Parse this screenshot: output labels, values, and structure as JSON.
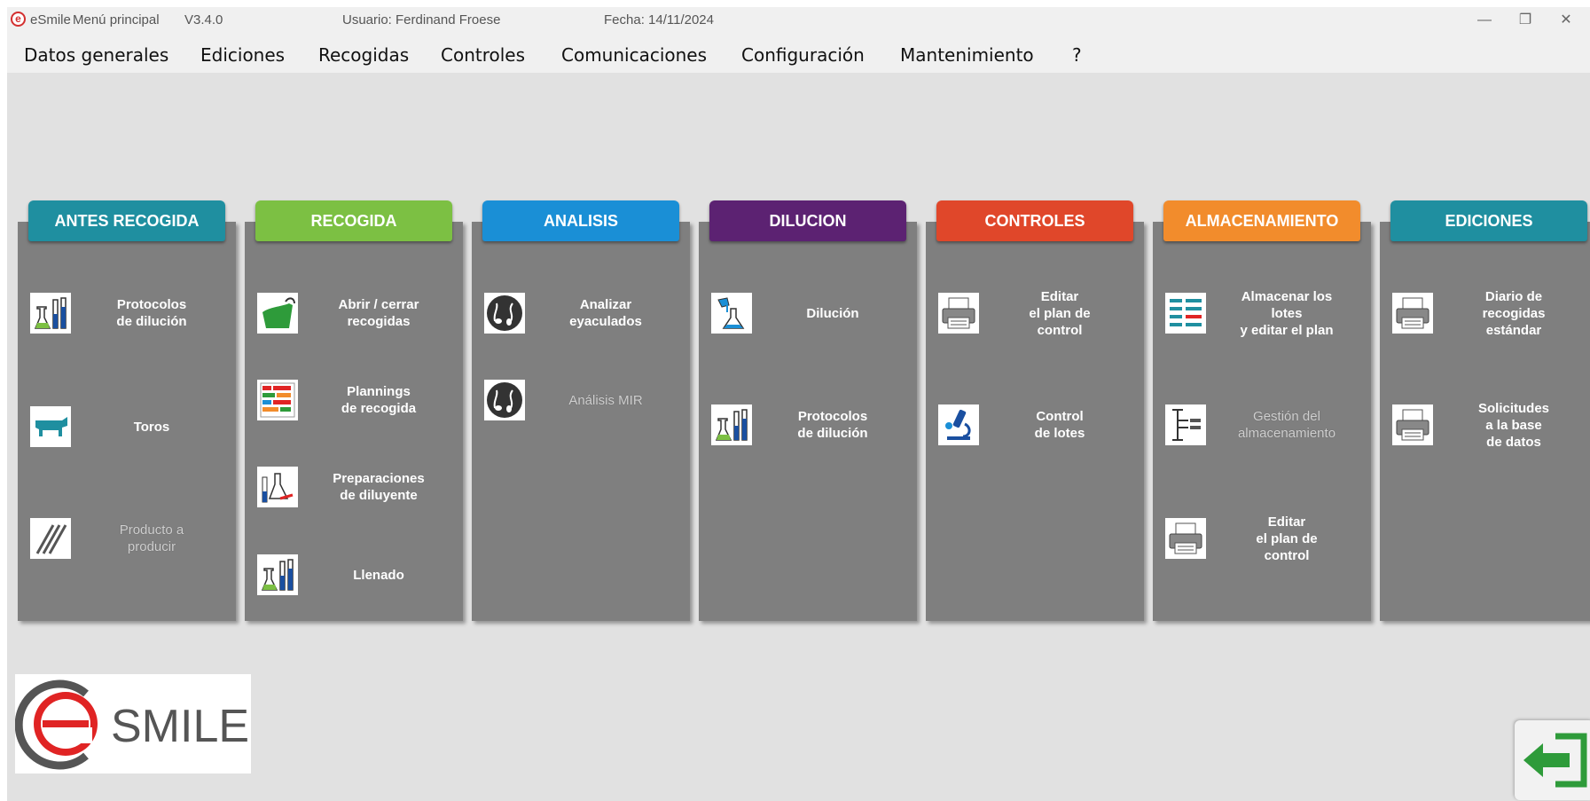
{
  "titlebar": {
    "app": "eSmile",
    "menu": "Menú principal",
    "version": "V3.4.0",
    "user": "Usuario: Ferdinand Froese",
    "date": "Fecha: 14/11/2024"
  },
  "menu": [
    "Datos generales",
    "Ediciones",
    "Recogidas",
    "Controles",
    "Comunicaciones",
    "Configuración",
    "Mantenimiento",
    "?"
  ],
  "panels": [
    {
      "title": "ANTES RECOGIDA",
      "color": "#1f8fa0",
      "items": [
        {
          "lines": [
            "Protocolos",
            "de dilución"
          ],
          "icon": "flask-tubes-icon",
          "enabled": true
        },
        {
          "lines": [
            "Toros"
          ],
          "icon": "bull-icon",
          "enabled": true
        },
        {
          "lines": [
            "Producto a",
            "producir"
          ],
          "icon": "straws-icon",
          "enabled": false
        }
      ]
    },
    {
      "title": "RECOGIDA",
      "color": "#7cc043",
      "items": [
        {
          "lines": [
            "Abrir / cerrar",
            "recogidas"
          ],
          "icon": "collection-cup-icon",
          "enabled": true
        },
        {
          "lines": [
            "Plannings",
            "de recogida"
          ],
          "icon": "planning-grid-icon",
          "enabled": true
        },
        {
          "lines": [
            "Preparaciones",
            "de diluyente"
          ],
          "icon": "diluent-prep-icon",
          "enabled": true
        },
        {
          "lines": [
            "Llenado"
          ],
          "icon": "flask-tubes-icon",
          "enabled": true
        }
      ]
    },
    {
      "title": "ANALISIS",
      "color": "#1a8fd6",
      "items": [
        {
          "lines": [
            "Analizar",
            "eyaculados"
          ],
          "icon": "sperm-cells-icon",
          "enabled": true
        },
        {
          "lines": [
            "Análisis MIR"
          ],
          "icon": "sperm-cells-icon",
          "enabled": false
        }
      ]
    },
    {
      "title": "DILUCION",
      "color": "#5c2272",
      "items": [
        {
          "lines": [
            "Dilución"
          ],
          "icon": "pour-flask-icon",
          "enabled": true
        },
        {
          "lines": [
            "Protocolos",
            "de dilución"
          ],
          "icon": "flask-tubes-icon",
          "enabled": true
        }
      ]
    },
    {
      "title": "CONTROLES",
      "color": "#e0472a",
      "items": [
        {
          "lines": [
            "Editar",
            "el plan de",
            "control"
          ],
          "icon": "printer-icon",
          "enabled": true
        },
        {
          "lines": [
            "Control",
            "de lotes"
          ],
          "icon": "microscope-icon",
          "enabled": true
        }
      ]
    },
    {
      "title": "ALMACENAMIENTO",
      "color": "#f28c2c",
      "items": [
        {
          "lines": [
            "Almacenar los",
            "lotes",
            "y editar el plan"
          ],
          "icon": "storage-list-icon",
          "enabled": true
        },
        {
          "lines": [
            "Gestión del",
            "almacenamiento"
          ],
          "icon": "storage-tree-icon",
          "enabled": false
        },
        {
          "lines": [
            "Editar",
            "el plan de",
            "control"
          ],
          "icon": "printer-icon",
          "enabled": true
        }
      ]
    },
    {
      "title": "EDICIONES",
      "color": "#1f8fa0",
      "items": [
        {
          "lines": [
            "Diario de",
            "recogidas",
            "estándar"
          ],
          "icon": "printer-icon",
          "enabled": true
        },
        {
          "lines": [
            "Solicitudes",
            "a la base",
            "de datos"
          ],
          "icon": "printer-icon",
          "enabled": true
        }
      ]
    }
  ],
  "logo": {
    "text": "SMILE",
    "letter": "e"
  },
  "exit": {
    "icon": "exit-arrow-icon"
  }
}
